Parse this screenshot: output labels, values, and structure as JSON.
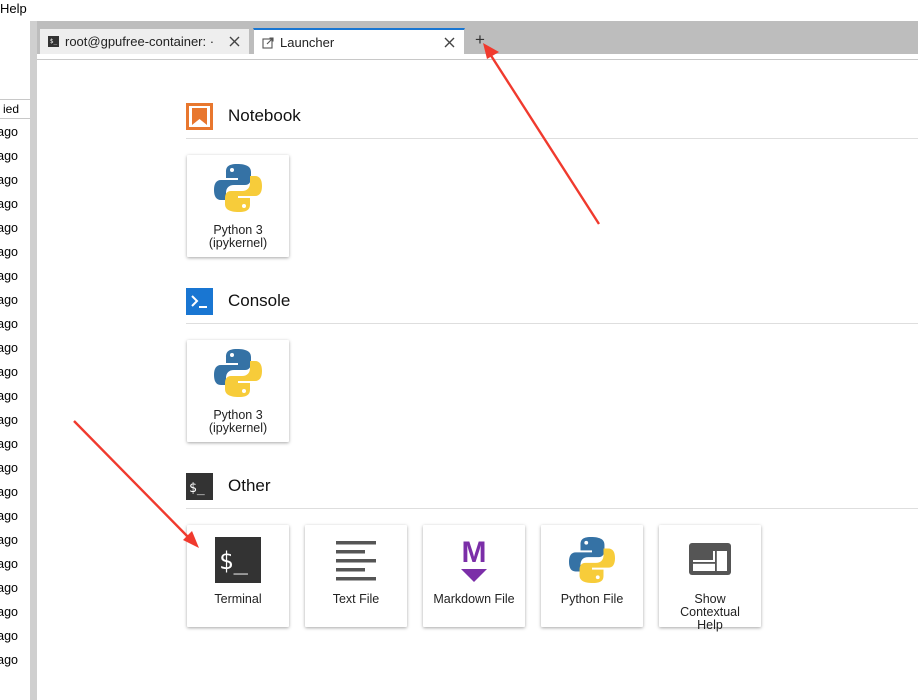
{
  "menubar": {
    "help": "Help"
  },
  "file_browser": {
    "header_fragment": "ied",
    "rows": [
      "ago",
      "ago",
      "ago",
      "ago",
      "ago",
      "ago",
      "ago",
      "ago",
      "ago",
      "ago",
      "ago",
      "ago",
      "ago",
      "ago",
      "ago",
      "ago",
      "ago",
      "ago",
      "ago",
      "ago",
      "ago",
      "ago",
      "ago"
    ]
  },
  "tabs": [
    {
      "label": "root@gpufree-container: ·",
      "type": "terminal"
    },
    {
      "label": "Launcher",
      "type": "launcher"
    }
  ],
  "add_tab_symbol": "+",
  "launcher": {
    "sections": [
      {
        "title": "Notebook",
        "items": [
          {
            "label_line1": "Python 3",
            "label_line2": "(ipykernel)"
          }
        ]
      },
      {
        "title": "Console",
        "items": [
          {
            "label_line1": "Python 3",
            "label_line2": "(ipykernel)"
          }
        ]
      },
      {
        "title": "Other",
        "items": [
          {
            "label": "Terminal"
          },
          {
            "label": "Text File"
          },
          {
            "label": "Markdown File"
          },
          {
            "label": "Python File"
          },
          {
            "label_line1": "Show",
            "label_line2": "Contextual",
            "label_line3": "Help"
          }
        ]
      }
    ],
    "terminal_icon_text": "$_",
    "markdown_icon_text": "M"
  },
  "colors": {
    "notebook_icon": "#e8772e",
    "console_icon": "#1976d2",
    "other_icon": "#333333",
    "active_tab_accent": "#1976d2",
    "annotation_arrow": "#f03a2e"
  }
}
